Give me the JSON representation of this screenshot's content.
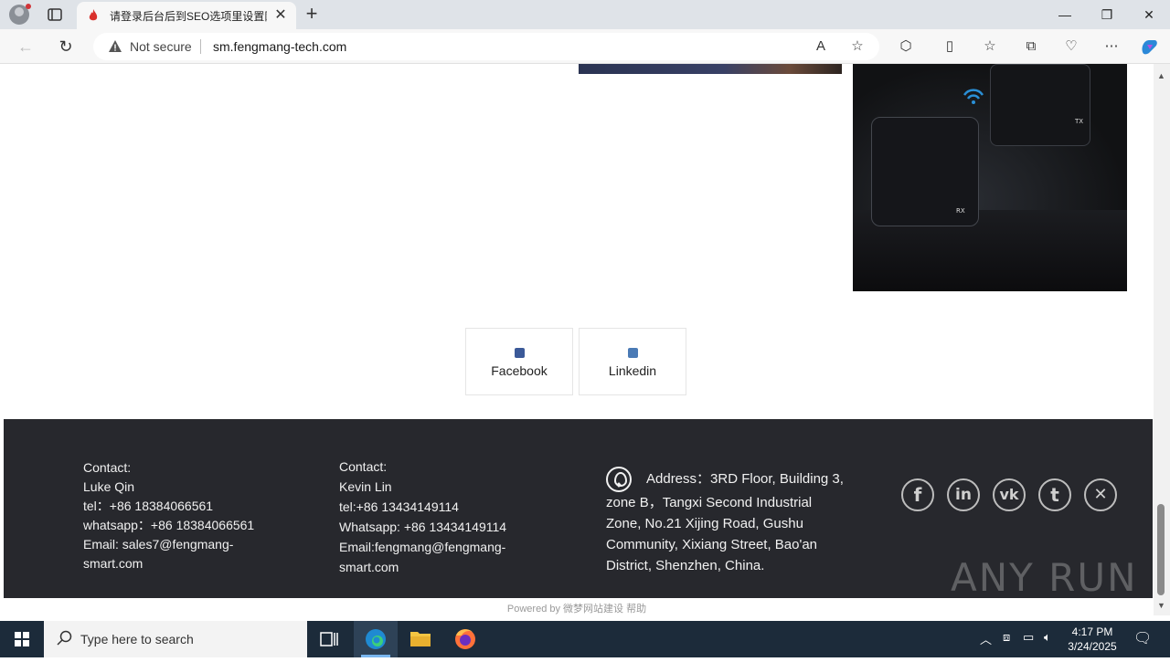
{
  "browser": {
    "tab_title": "请登录后台后到SEO选项里设置网",
    "security_label": "Not secure",
    "url": "sm.fengmang-tech.com"
  },
  "social_buttons": [
    {
      "label": "Facebook"
    },
    {
      "label": "Linkedin"
    }
  ],
  "product_image": {
    "labels": [
      "TX",
      "RX"
    ]
  },
  "footer": {
    "contact1": {
      "heading": "Contact:",
      "name": "Luke Qin",
      "tel": "tel：+86 18384066561",
      "whatsapp": "whatsapp：+86 18384066561",
      "email_line1": "Email: sales7@fengmang-",
      "email_line2": "smart.com"
    },
    "contact2": {
      "heading": "Contact:",
      "name": "Kevin Lin",
      "tel": "tel:+86 13434149114",
      "whatsapp": "Whatsapp: +86 13434149114",
      "email_line1": "Email:fengmang@fengmang-",
      "email_line2": "smart.com"
    },
    "address": "Address：3RD Floor, Building 3, zone B，Tangxi Second Industrial Zone, No.21 Xijing Road, Gushu Community, Xixiang Street, Bao'an District, Shenzhen, China.",
    "social_icons": [
      "facebook-icon",
      "linkedin-icon",
      "vk-icon",
      "tumblr-icon",
      "x-icon"
    ],
    "watermark": "ANY RUN"
  },
  "powered_by": "Powered by 微梦网站建设  帮助",
  "taskbar": {
    "search_placeholder": "Type here to search",
    "time": "4:17 PM",
    "date": "3/24/2025"
  }
}
